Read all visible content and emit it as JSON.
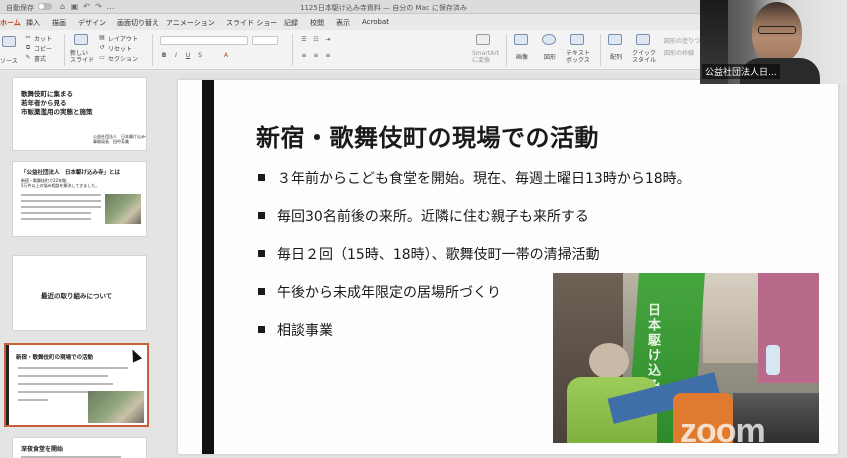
{
  "titlebar": {
    "autosave": "自動保存",
    "doc_title": "1125日本駆け込み寺資料 — 自分の Mac に保存済み"
  },
  "tabs": [
    "ホーム",
    "挿入",
    "描画",
    "デザイン",
    "画面切り替え",
    "アニメーション",
    "スライド ショー",
    "記録",
    "校閲",
    "表示",
    "Acrobat"
  ],
  "ribbon": {
    "source_label": "ソース",
    "cut": "カット",
    "copy": "コピー",
    "format": "書式",
    "new_slide": "新しい\nスライド",
    "layout": "レイアウト",
    "reset": "リセット",
    "section": "セクション",
    "smartart": "SmartArt\nに変換",
    "image": "画像",
    "shape": "図形",
    "textbox": "テキスト\nボックス",
    "arrange": "配列",
    "quick_style": "クイック\nスタイル",
    "shape_fill": "図形の塗りつ",
    "shape_outline": "図形の枠線"
  },
  "thumbnails": [
    {
      "title": "歌舞伎町に集まる\n若年者から見る\n市販薬濫用の実態と施策",
      "footer": "公益社団法人　日本駆け込み寺\n事務局長　田中芳美"
    },
    {
      "title": "「公益社団法人　日本駆け込み寺」とは",
      "sub": "新宿・歌舞伎町で22年間、\n5万件以上の悩み相談を解決してきました。"
    },
    {
      "title": "最近の取り組みについて"
    },
    {
      "title": "新宿・歌舞伎町の現場での活動"
    },
    {
      "title": "深夜食堂を開始"
    }
  ],
  "slide": {
    "title": "新宿・歌舞伎町の現場での活動",
    "bullets": [
      "３年前からこども食堂を開始。現在、毎週土曜日13時から18時。",
      "毎回30名前後の来所。近隣に住む親子も来所する",
      "毎日２回（15時、18時）、歌舞伎町一帯の清掃活動",
      "午後から未成年限定の居場所づくり",
      "相談事業"
    ],
    "banner_text": "日本駆け込み寺"
  },
  "video": {
    "participant_name": "公益社団法人日..."
  },
  "watermark": "zoom",
  "colors": {
    "accent": "#c43e1c",
    "selected_border": "#c5603a",
    "banner_green": "#3d9a3b"
  }
}
